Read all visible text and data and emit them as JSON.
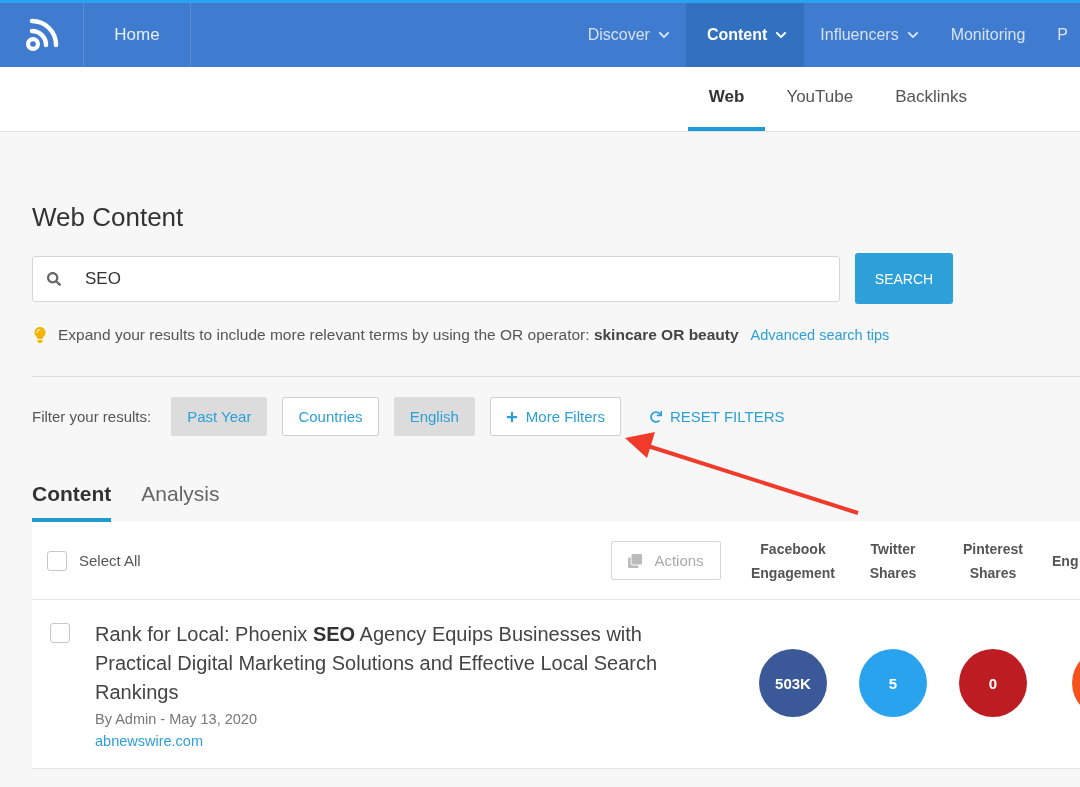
{
  "nav": {
    "home": "Home",
    "items": [
      {
        "label": "Discover",
        "dropdown": true,
        "selected": false
      },
      {
        "label": "Content",
        "dropdown": true,
        "selected": true
      },
      {
        "label": "Influencers",
        "dropdown": true,
        "selected": false
      },
      {
        "label": "Monitoring",
        "dropdown": false,
        "selected": false
      },
      {
        "label": "P",
        "dropdown": false,
        "selected": false
      }
    ]
  },
  "subtabs": [
    {
      "label": "Web",
      "selected": true
    },
    {
      "label": "YouTube",
      "selected": false
    },
    {
      "label": "Backlinks",
      "selected": false
    }
  ],
  "title": "Web Content",
  "search": {
    "value": "SEO",
    "button": "SEARCH"
  },
  "tip": {
    "text": "Expand your results to include more relevant terms by using the OR operator: **skincare OR beauty**",
    "link": "Advanced search tips"
  },
  "filters": {
    "label": "Filter your results:",
    "chips": [
      {
        "label": "Past Year",
        "selected": true
      },
      {
        "label": "Countries",
        "selected": false
      },
      {
        "label": "English",
        "selected": true
      }
    ],
    "more": "More Filters",
    "reset": "RESET FILTERS"
  },
  "view_tabs": [
    {
      "label": "Content",
      "selected": true
    },
    {
      "label": "Analysis",
      "selected": false
    }
  ],
  "table": {
    "select_all": {
      "label": "Select All",
      "checked": false
    },
    "actions": "Actions",
    "columns": [
      "Facebook Engagement",
      "Twitter Shares",
      "Pinterest Shares",
      "Eng"
    ],
    "rows": [
      {
        "checked": false,
        "title": "Rank for Local: Phoenix **SEO** Agency Equips Businesses with Practical Digital Marketing Solutions and Effective Local Search Rankings",
        "byline": "By Admin - May 13, 2020",
        "source": "abnewswire.com",
        "metrics": [
          {
            "value": "503K",
            "color": "#3b5998"
          },
          {
            "value": "5",
            "color": "#2aa3ef"
          },
          {
            "value": "0",
            "color": "#bd1c23"
          },
          {
            "color": "#f4511e"
          }
        ]
      }
    ]
  }
}
